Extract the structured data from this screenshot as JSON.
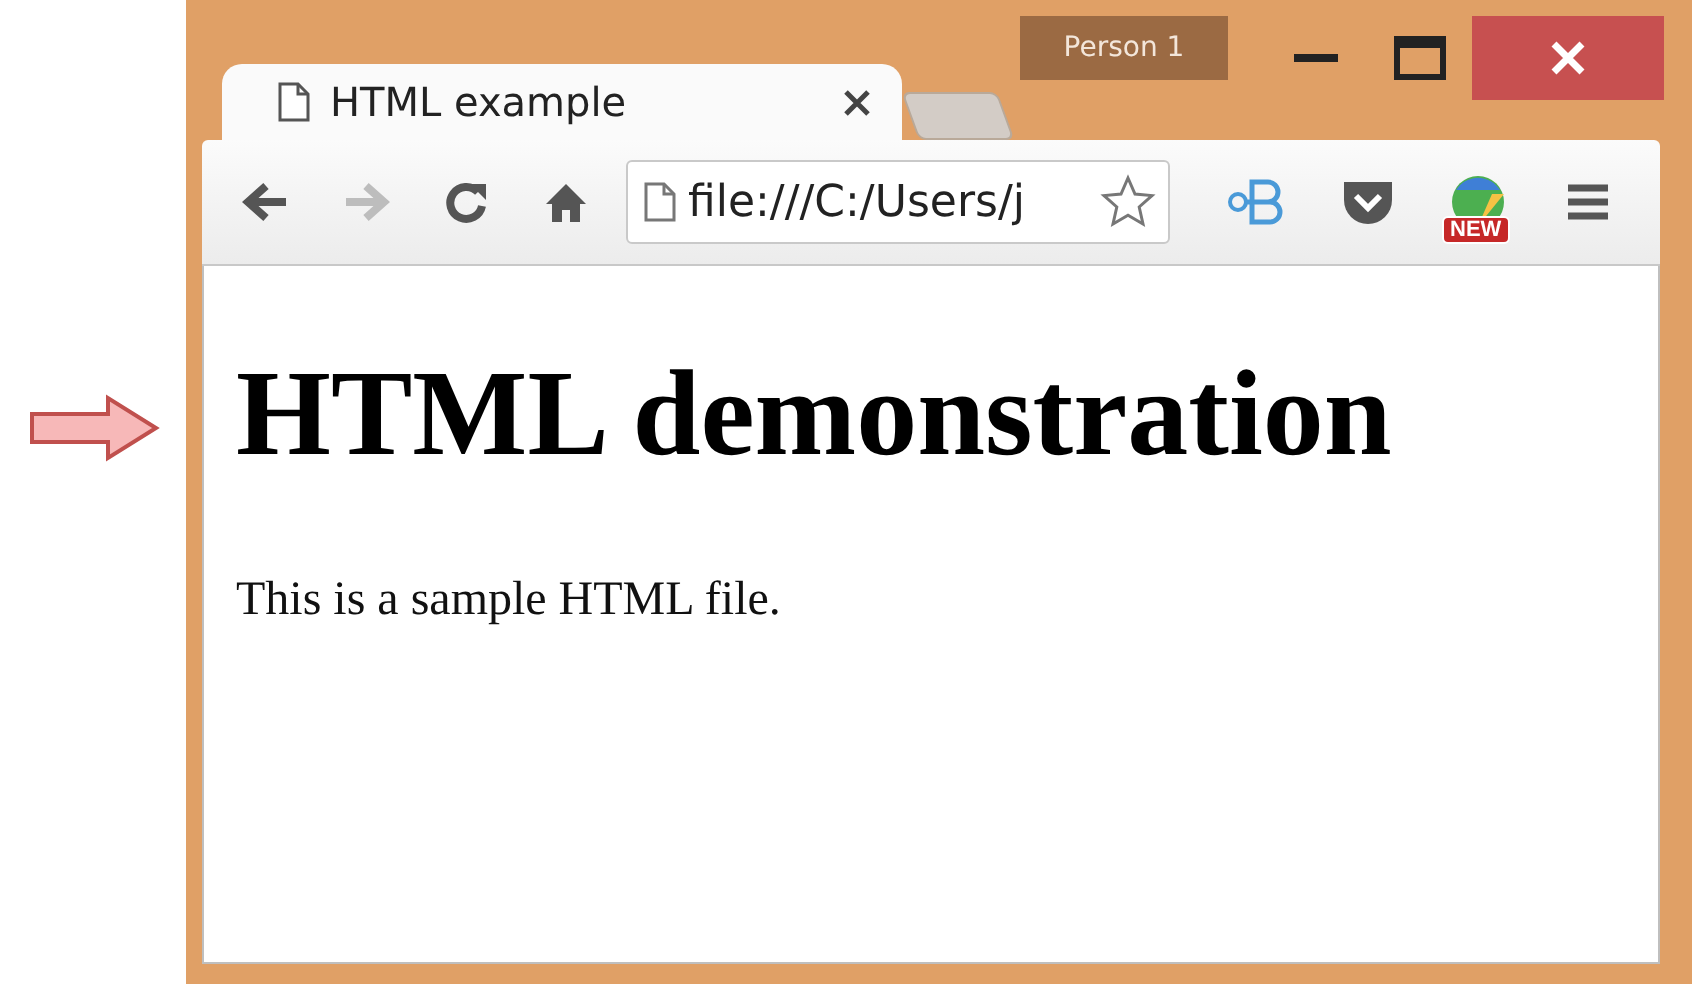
{
  "profile": {
    "label": "Person 1"
  },
  "tabs": [
    {
      "title": "HTML example",
      "selected": true
    }
  ],
  "navigation": [
    {
      "kind": "back",
      "disabled": false
    },
    {
      "kind": "forward",
      "disabled": true
    },
    {
      "kind": "reload",
      "disabled": false
    },
    {
      "kind": "home",
      "disabled": false
    }
  ],
  "address_bar": {
    "value": "file:///C:/Users/j"
  },
  "extensions": [
    {
      "kind": "bookmark-b"
    },
    {
      "kind": "pocket"
    },
    {
      "kind": "map",
      "badge": "NEW"
    }
  ],
  "page": {
    "heading": "HTML demonstration",
    "paragraph": "This is a sample HTML file."
  }
}
